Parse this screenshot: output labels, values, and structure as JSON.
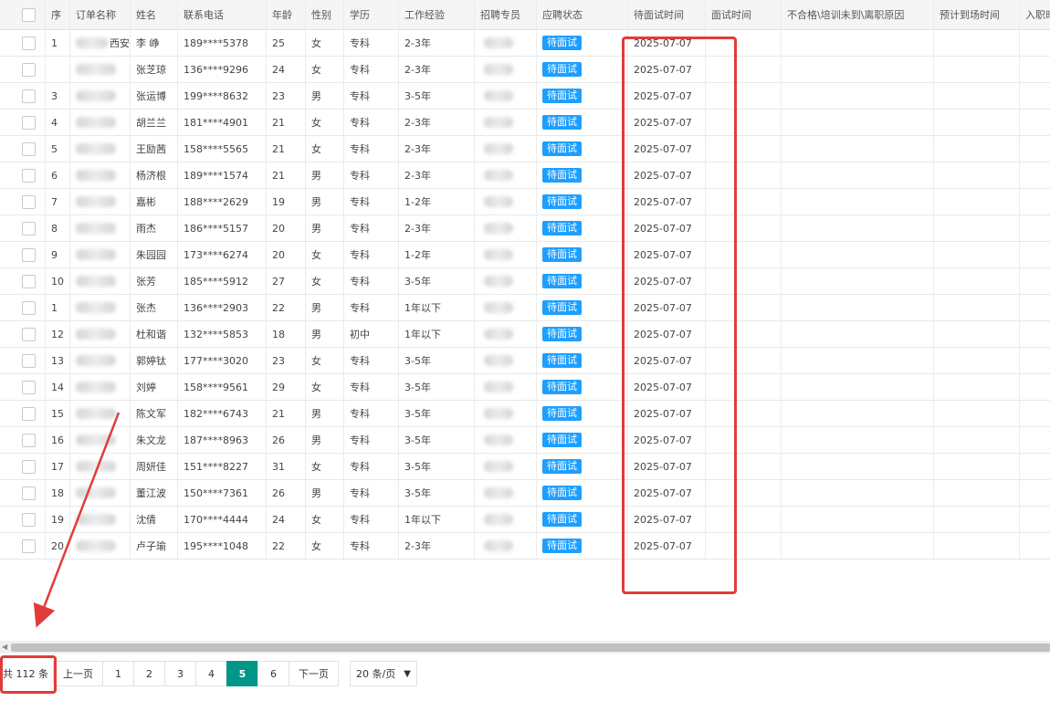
{
  "columns": {
    "seq": "序",
    "order": "订单名称",
    "name": "姓名",
    "phone": "联系电话",
    "age": "年龄",
    "gender": "性别",
    "edu": "学历",
    "exp": "工作经验",
    "recruiter": "招聘专员",
    "status": "应聘状态",
    "pending_time": "待面试时间",
    "interview_time": "面试时间",
    "reason": "不合格\\培训未到\\离职原因",
    "expected_arrival": "预计到场时间",
    "entry": "入职时"
  },
  "rows": [
    {
      "seq": "1",
      "order": "西安",
      "name": "李 峥",
      "phone": "189****5378",
      "age": "25",
      "gender": "女",
      "edu": "专科",
      "exp": "2-3年",
      "status": "待面试",
      "pending": "2025-07-07"
    },
    {
      "seq": "",
      "order": "",
      "name": "张芝琼",
      "phone": "136****9296",
      "age": "24",
      "gender": "女",
      "edu": "专科",
      "exp": "2-3年",
      "status": "待面试",
      "pending": "2025-07-07"
    },
    {
      "seq": "3",
      "order": "",
      "name": "张运博",
      "phone": "199****8632",
      "age": "23",
      "gender": "男",
      "edu": "专科",
      "exp": "3-5年",
      "status": "待面试",
      "pending": "2025-07-07"
    },
    {
      "seq": "4",
      "order": "",
      "name": "胡兰兰",
      "phone": "181****4901",
      "age": "21",
      "gender": "女",
      "edu": "专科",
      "exp": "2-3年",
      "status": "待面试",
      "pending": "2025-07-07"
    },
    {
      "seq": "5",
      "order": "",
      "name": "王励茜",
      "phone": "158****5565",
      "age": "21",
      "gender": "女",
      "edu": "专科",
      "exp": "2-3年",
      "status": "待面试",
      "pending": "2025-07-07"
    },
    {
      "seq": "6",
      "order": "",
      "name": "杨济根",
      "phone": "189****1574",
      "age": "21",
      "gender": "男",
      "edu": "专科",
      "exp": "2-3年",
      "status": "待面试",
      "pending": "2025-07-07"
    },
    {
      "seq": "7",
      "order": "",
      "name": "嘉彬",
      "phone": "188****2629",
      "age": "19",
      "gender": "男",
      "edu": "专科",
      "exp": "1-2年",
      "status": "待面试",
      "pending": "2025-07-07"
    },
    {
      "seq": "8",
      "order": "",
      "name": "雨杰",
      "phone": "186****5157",
      "age": "20",
      "gender": "男",
      "edu": "专科",
      "exp": "2-3年",
      "status": "待面试",
      "pending": "2025-07-07"
    },
    {
      "seq": "9",
      "order": "",
      "name": "朱园园",
      "phone": "173****6274",
      "age": "20",
      "gender": "女",
      "edu": "专科",
      "exp": "1-2年",
      "status": "待面试",
      "pending": "2025-07-07"
    },
    {
      "seq": "10",
      "order": "",
      "name": "张芳",
      "phone": "185****5912",
      "age": "27",
      "gender": "女",
      "edu": "专科",
      "exp": "3-5年",
      "status": "待面试",
      "pending": "2025-07-07"
    },
    {
      "seq": "1",
      "order": "",
      "name": "张杰",
      "phone": "136****2903",
      "age": "22",
      "gender": "男",
      "edu": "专科",
      "exp": "1年以下",
      "status": "待面试",
      "pending": "2025-07-07"
    },
    {
      "seq": "12",
      "order": "",
      "name": "杜和谐",
      "phone": "132****5853",
      "age": "18",
      "gender": "男",
      "edu": "初中",
      "exp": "1年以下",
      "status": "待面试",
      "pending": "2025-07-07"
    },
    {
      "seq": "13",
      "order": "",
      "name": "郭婷钛",
      "phone": "177****3020",
      "age": "23",
      "gender": "女",
      "edu": "专科",
      "exp": "3-5年",
      "status": "待面试",
      "pending": "2025-07-07"
    },
    {
      "seq": "14",
      "order": "",
      "name": "刘婷",
      "phone": "158****9561",
      "age": "29",
      "gender": "女",
      "edu": "专科",
      "exp": "3-5年",
      "status": "待面试",
      "pending": "2025-07-07"
    },
    {
      "seq": "15",
      "order": "",
      "name": "陈文军",
      "phone": "182****6743",
      "age": "21",
      "gender": "男",
      "edu": "专科",
      "exp": "3-5年",
      "status": "待面试",
      "pending": "2025-07-07"
    },
    {
      "seq": "16",
      "order": "",
      "name": "朱文龙",
      "phone": "187****8963",
      "age": "26",
      "gender": "男",
      "edu": "专科",
      "exp": "3-5年",
      "status": "待面试",
      "pending": "2025-07-07"
    },
    {
      "seq": "17",
      "order": "",
      "name": "周妍佳",
      "phone": "151****8227",
      "age": "31",
      "gender": "女",
      "edu": "专科",
      "exp": "3-5年",
      "status": "待面试",
      "pending": "2025-07-07"
    },
    {
      "seq": "18",
      "order": "",
      "name": "董江波",
      "phone": "150****7361",
      "age": "26",
      "gender": "男",
      "edu": "专科",
      "exp": "3-5年",
      "status": "待面试",
      "pending": "2025-07-07"
    },
    {
      "seq": "19",
      "order": "",
      "name": "沈倩",
      "phone": "170****4444",
      "age": "24",
      "gender": "女",
      "edu": "专科",
      "exp": "1年以下",
      "status": "待面试",
      "pending": "2025-07-07"
    },
    {
      "seq": "20",
      "order": "",
      "name": "卢子瑜",
      "phone": "195****1048",
      "age": "22",
      "gender": "女",
      "edu": "专科",
      "exp": "2-3年",
      "status": "待面试",
      "pending": "2025-07-07"
    }
  ],
  "pager": {
    "total": "共 112 条",
    "prev": "上一页",
    "pages": [
      "1",
      "2",
      "3",
      "4",
      "5",
      "6"
    ],
    "current": "5",
    "next": "下一页",
    "page_size": "20 条/页"
  },
  "colors": {
    "tag": "#1e9fff",
    "active_page": "#009688",
    "highlight": "#e23b3b"
  }
}
